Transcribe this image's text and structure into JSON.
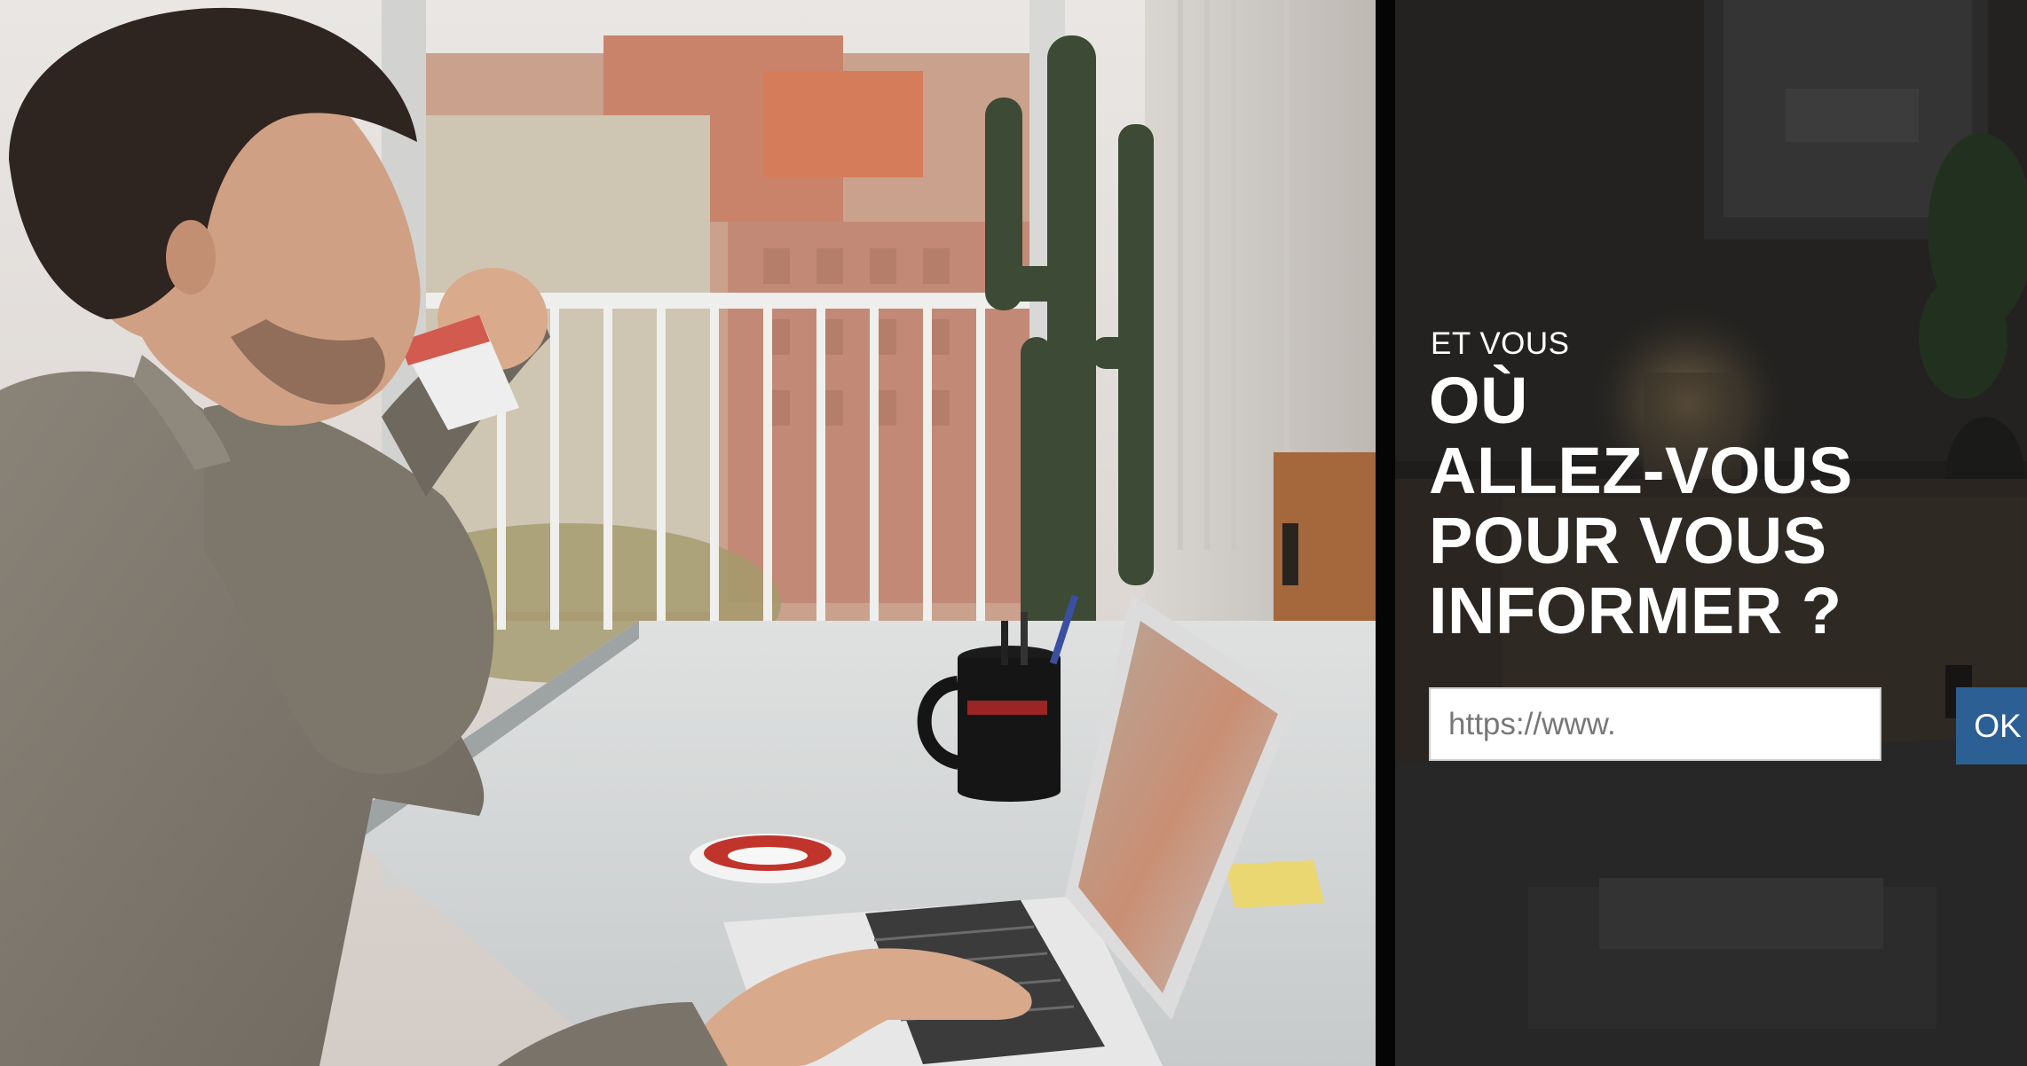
{
  "headline": {
    "pretitle": "ET VOUS",
    "lines": [
      "OÙ",
      "ALLEZ-VOUS",
      "POUR VOUS",
      "INFORMER ?"
    ]
  },
  "url_form": {
    "input_placeholder": "https://www.",
    "input_value": "",
    "submit_label": "OK"
  },
  "colors": {
    "accent_button": "#2c5f94",
    "right_panel_bg": "#1c1b1a",
    "headline_text": "#ffffff"
  },
  "images": {
    "left_photo": "man-drinking-coffee-at-laptop-photo",
    "right_background": "dimmed-room-background-photo"
  }
}
